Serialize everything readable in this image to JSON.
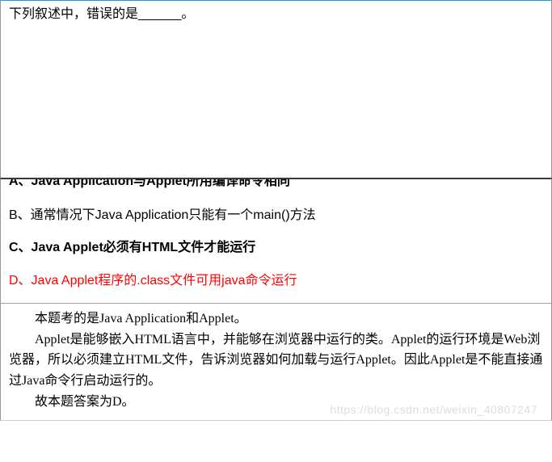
{
  "question": {
    "stem": "下列叙述中，错误的是______。"
  },
  "options": {
    "a": "A、Java Application与Applet所用编译命令相同",
    "b": "B、通常情况下Java Application只能有一个main()方法",
    "c": "C、Java Applet必须有HTML文件才能运行",
    "d": "D、Java Applet程序的.class文件可用java命令运行"
  },
  "explanation": {
    "line1": "本题考的是Java Application和Applet。",
    "line2": "Applet是能够嵌入HTML语言中，并能够在浏览器中运行的类。Applet的运行环境是Web浏览器，所以必须建立HTML文件，告诉浏览器如何加载与运行Applet。因此Applet是不能直接通过Java命令行启动运行的。",
    "line3": "故本题答案为D。"
  },
  "watermark": "https://blog.csdn.net/weixin_40807247"
}
